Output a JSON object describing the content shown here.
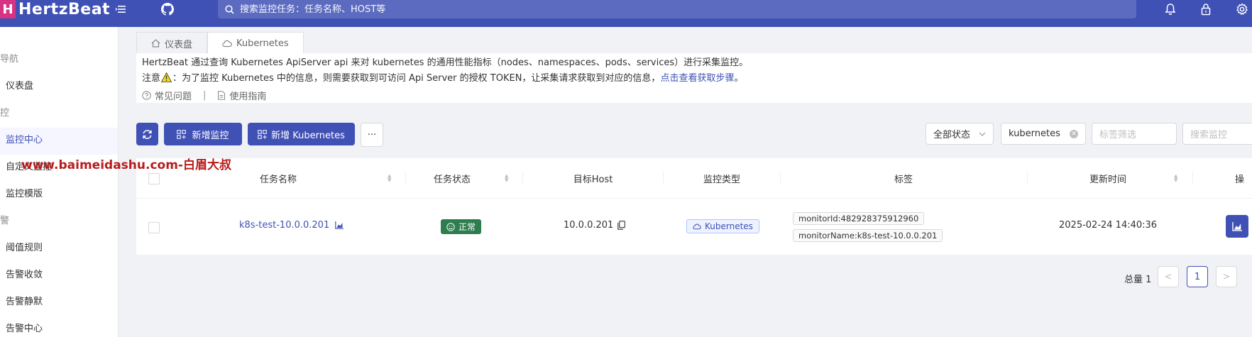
{
  "header": {
    "logo_text": "HertzBeat",
    "search_placeholder": "搜索监控任务：任务名称、HOST等",
    "icons": [
      "menu-icon",
      "github-icon",
      "search-icon",
      "bell-icon",
      "lock-icon",
      "gear-icon"
    ]
  },
  "sidebar": {
    "groups": [
      {
        "label": "导航",
        "items": [
          {
            "label": "仪表盘"
          }
        ]
      },
      {
        "label": "控",
        "items": [
          {
            "label": "监控中心",
            "active": true
          },
          {
            "label": "自定义监控"
          },
          {
            "label": "监控模版"
          }
        ]
      },
      {
        "label": "警",
        "items": [
          {
            "label": "阈值规则"
          },
          {
            "label": "告警收敛"
          },
          {
            "label": "告警静默"
          },
          {
            "label": "告警中心"
          }
        ]
      }
    ]
  },
  "tabs": [
    {
      "label": "仪表盘",
      "icon": "home-icon"
    },
    {
      "label": "Kubernetes",
      "icon": "cloud-icon",
      "active": true
    }
  ],
  "info": {
    "line1": "HertzBeat 通过查询 Kubernetes ApiServer api 来对 kubernetes 的通用性能指标（nodes、namespaces、pods、services）进行采集监控。",
    "line2_prefix": "注意",
    "line2_text": "：为了监控 Kubernetes 中的信息，则需要获取到可访问 Api Server 的授权 TOKEN，让采集请求获取到对应的信息，",
    "line2_link": "点击查看获取步骤",
    "line2_suffix": "。",
    "faq": "常见问题",
    "divider": "|",
    "guide": "使用指南"
  },
  "toolbar": {
    "add_monitor": "新增监控",
    "add_kubernetes": "新增 Kubernetes",
    "more": "···",
    "status_filter": "全部状态",
    "app_filter_value": "kubernetes",
    "tag_filter_placeholder": "标签筛选",
    "search_placeholder": "搜索监控"
  },
  "table": {
    "columns": [
      "任务名称",
      "任务状态",
      "目标Host",
      "监控类型",
      "标签",
      "更新时间",
      "操"
    ],
    "rows": [
      {
        "name": "k8s-test-10.0.0.201",
        "status": "正常",
        "host": "10.0.0.201",
        "type": "Kubernetes",
        "labels": [
          "monitorId:482928375912960",
          "monitorName:k8s-test-10.0.0.201"
        ],
        "updated": "2025-02-24 14:40:36"
      }
    ]
  },
  "pagination": {
    "total_label": "总量 1",
    "prev": "<",
    "current": "1",
    "next": ">"
  },
  "watermark": "www.baimeidashu.com-白眉大叔",
  "colors": {
    "primary": "#3f51b5",
    "status_ok": "#2e7d4f",
    "link": "#3f51b5",
    "watermark": "#b71c1c"
  }
}
